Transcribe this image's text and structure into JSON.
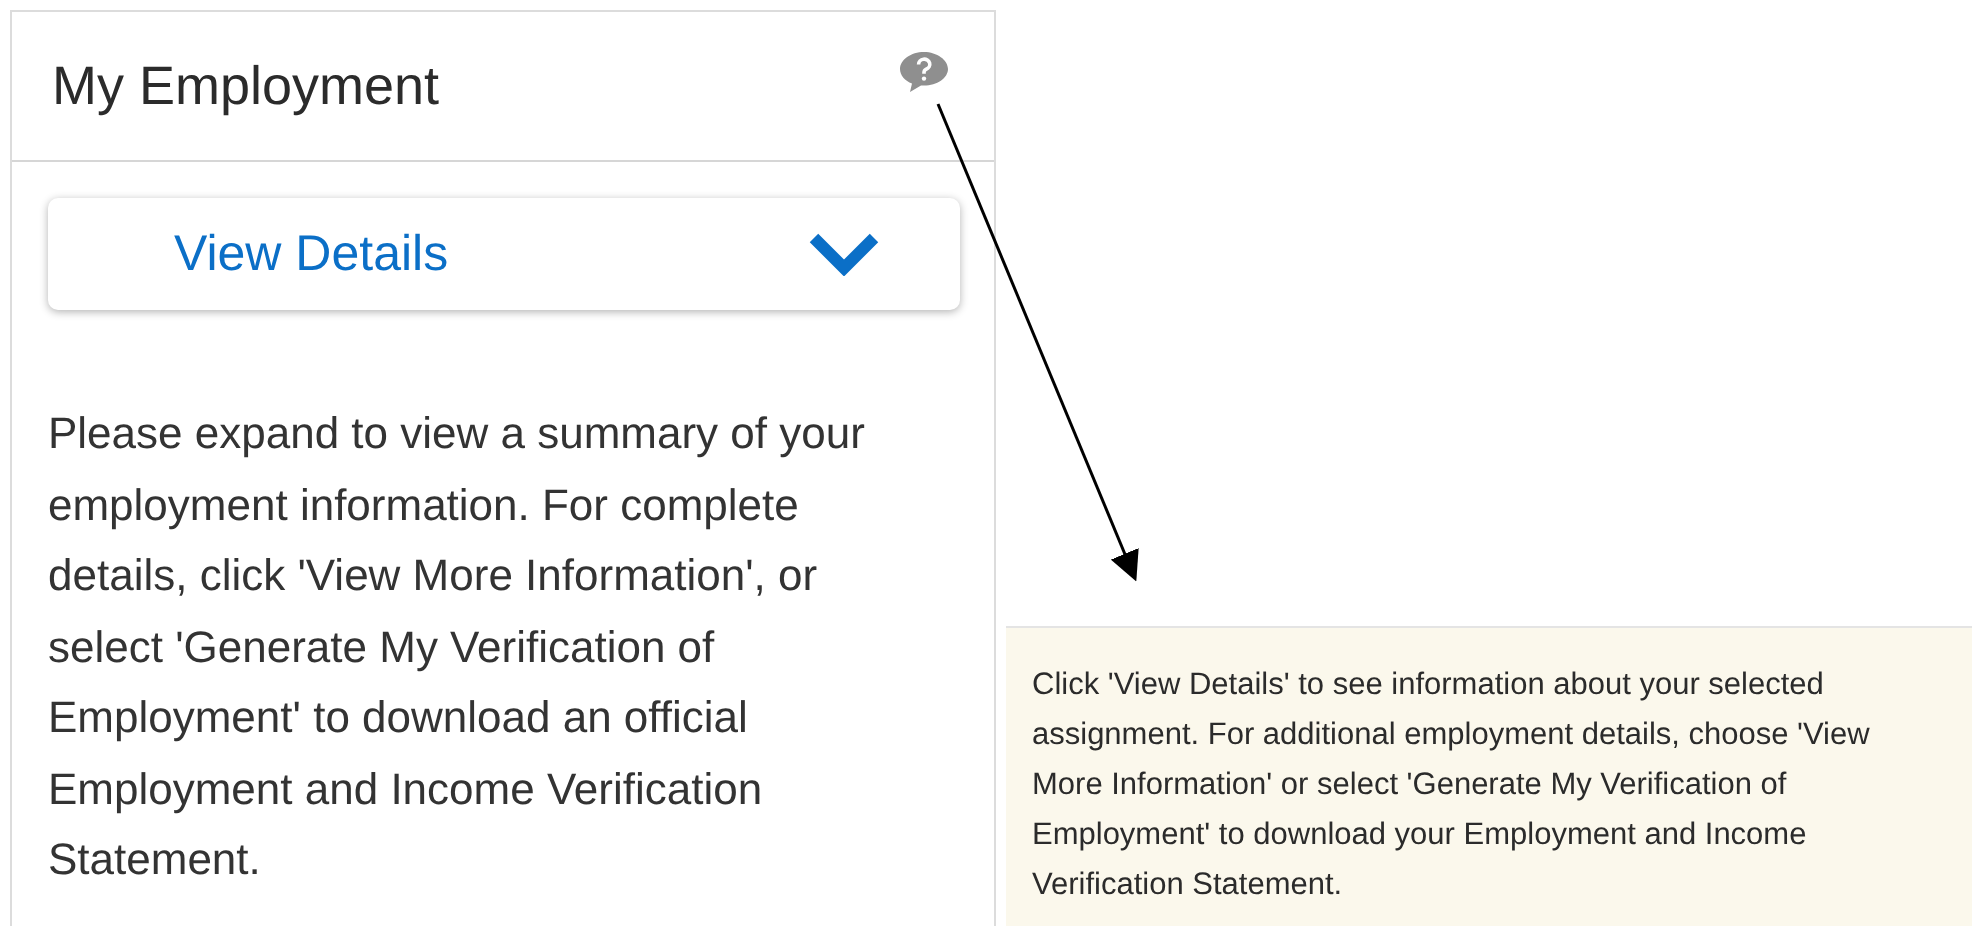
{
  "card": {
    "title": "My Employment",
    "details_button": {
      "label": "View Details",
      "expanded": false
    },
    "description": "Please expand to view a summary of your employment information. For complete details, click 'View More Information', or select 'Generate My Verification of Employment' to download an official Employment and Income Verification Statement."
  },
  "tooltip": {
    "text": "Click 'View Details' to see information about your selected assignment. For additional employment details, choose 'View More Information' or select 'Generate My Verification of Employment' to download your Employment and Income Verification Statement."
  }
}
